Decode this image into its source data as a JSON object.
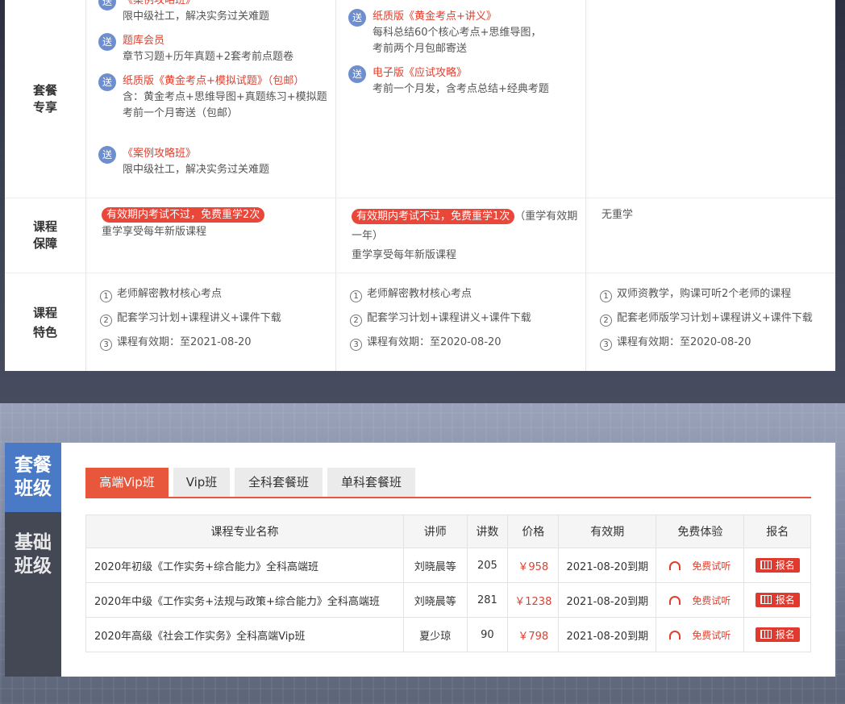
{
  "compare": {
    "rows": {
      "package": {
        "label": "套餐\n专享",
        "col1": [
          {
            "title": "《案例攻略班》",
            "desc": "限中级社工，解决实务过关难题"
          },
          {
            "title": "题库会员",
            "desc": "章节习题+历年真题+2套考前点题卷"
          },
          {
            "title": "纸质版《黄金考点+模拟试题》（包邮）",
            "desc": "含：黄金考点+思维导图+真题练习+模拟题\n考前一个月寄送（包邮）"
          },
          {
            "title": "《案例攻略班》",
            "desc": "限中级社工，解决实务过关难题"
          }
        ],
        "col2": [
          {
            "title": "纸质版《黄金考点+讲义》",
            "desc": "每科总结60个核心考点+思维导图，\n考前两个月包邮寄送"
          },
          {
            "title": "电子版《应试攻略》",
            "desc": "考前一个月发，含考点总结+经典考题"
          }
        ],
        "gift_badge": "送"
      },
      "guarantee": {
        "label": "课程\n保障",
        "col1_pill": "有效期内考试不过，免费重学2次",
        "col1_text": "重学享受每年新版课程",
        "col2_pill": "有效期内考试不过，免费重学1次",
        "col2_suffix": "（重学有效期一年）",
        "col2_text": "重学享受每年新版课程",
        "col3_text": "无重学"
      },
      "features": {
        "label": "课程\n特色",
        "col1": [
          "老师解密教材核心考点",
          "配套学习计划+课程讲义+课件下载",
          "课程有效期：至2021-08-20"
        ],
        "col2": [
          "老师解密教材核心考点",
          "配套学习计划+课程讲义+课件下载",
          "课程有效期：至2020-08-20"
        ],
        "col3": [
          "双师资教学，购课可听2个老师的课程",
          "配套老师版学习计划+课程讲义+课件下载",
          "课程有效期：至2020-08-20"
        ],
        "nums": [
          "1",
          "2",
          "3"
        ]
      }
    }
  },
  "panel": {
    "side_tabs": [
      {
        "label": "套餐\n班级",
        "active": true
      },
      {
        "label": "基础\n班级",
        "active": false
      }
    ],
    "tabs": [
      "高端Vip班",
      "Vip班",
      "全科套餐班",
      "单科套餐班"
    ],
    "active_tab": 0,
    "table": {
      "headers": [
        "课程专业名称",
        "讲师",
        "讲数",
        "价格",
        "有效期",
        "免费体验",
        "报名"
      ],
      "rows": [
        {
          "name": "2020年初级《工作实务+综合能力》全科高端班",
          "teacher": "刘晓晨等",
          "lessons": "205",
          "price": "￥958",
          "valid": "2021-08-20到期",
          "trial": "免费试听",
          "register": "报名"
        },
        {
          "name": "2020年中级《工作实务+法规与政策+综合能力》全科高端班",
          "teacher": "刘晓晨等",
          "lessons": "281",
          "price": "￥1238",
          "valid": "2021-08-20到期",
          "trial": "免费试听",
          "register": "报名"
        },
        {
          "name": "2020年高级《社会工作实务》全科高端Vip班",
          "teacher": "夏少琼",
          "lessons": "90",
          "price": "￥798",
          "valid": "2021-08-20到期",
          "trial": "免费试听",
          "register": "报名"
        }
      ]
    },
    "colors": {
      "accent": "#e8563b",
      "side_active": "#4a79c6",
      "side_bg": "#434854",
      "price": "#e0402f"
    }
  }
}
